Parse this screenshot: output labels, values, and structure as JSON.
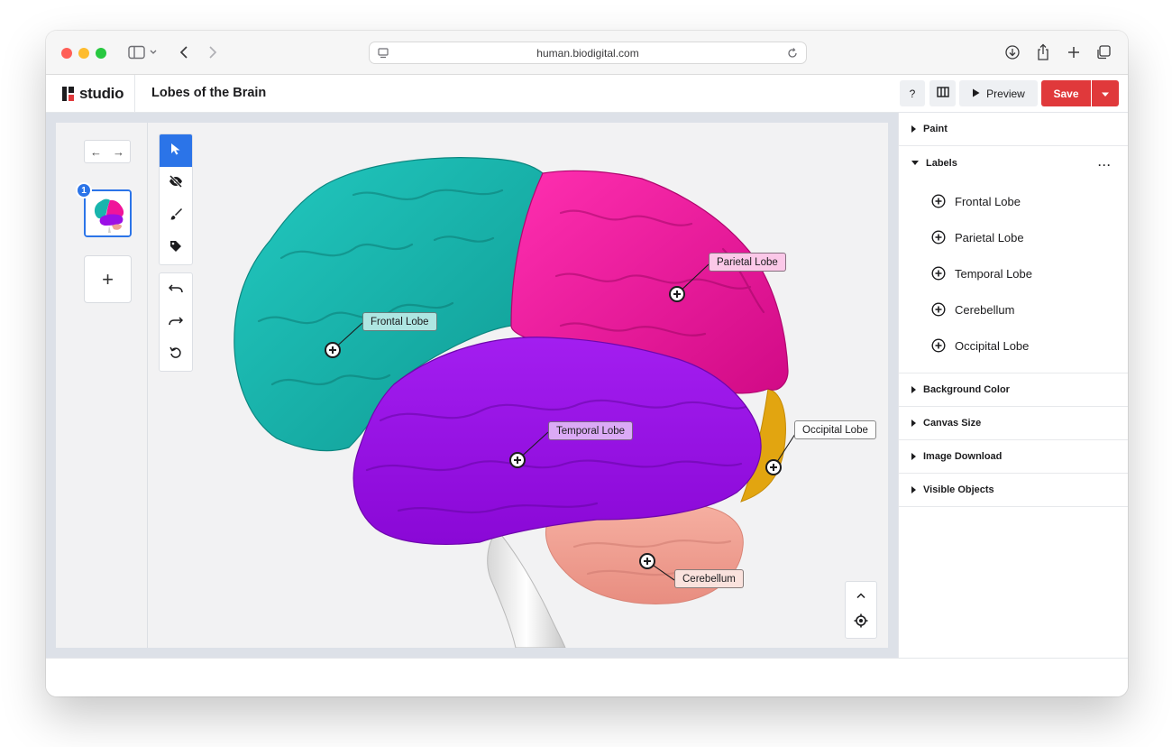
{
  "browser": {
    "url": "human.biodigital.com"
  },
  "header": {
    "logo_text": "studio",
    "title": "Lobes of the Brain",
    "help_label": "?",
    "preview_label": "Preview",
    "save_label": "Save"
  },
  "scenes": {
    "badge": "1",
    "add_label": "+"
  },
  "canvas_labels": {
    "frontal": "Frontal Lobe",
    "parietal": "Parietal Lobe",
    "temporal": "Temporal Lobe",
    "occipital": "Occipital Lobe",
    "cerebellum": "Cerebellum"
  },
  "panel": {
    "paint": "Paint",
    "labels": "Labels",
    "label_items": [
      "Frontal Lobe",
      "Parietal Lobe",
      "Temporal Lobe",
      "Cerebellum",
      "Occipital Lobe"
    ],
    "background_color": "Background Color",
    "canvas_size": "Canvas Size",
    "image_download": "Image Download",
    "visible_objects": "Visible Objects",
    "more": "···"
  },
  "colors": {
    "frontal": "#18b5ad",
    "parietal": "#f0149a",
    "temporal": "#9b10e6",
    "occipital": "#e2a510",
    "cerebellum": "#f0a093",
    "accent": "#2b74e8",
    "save": "#e0393b"
  }
}
